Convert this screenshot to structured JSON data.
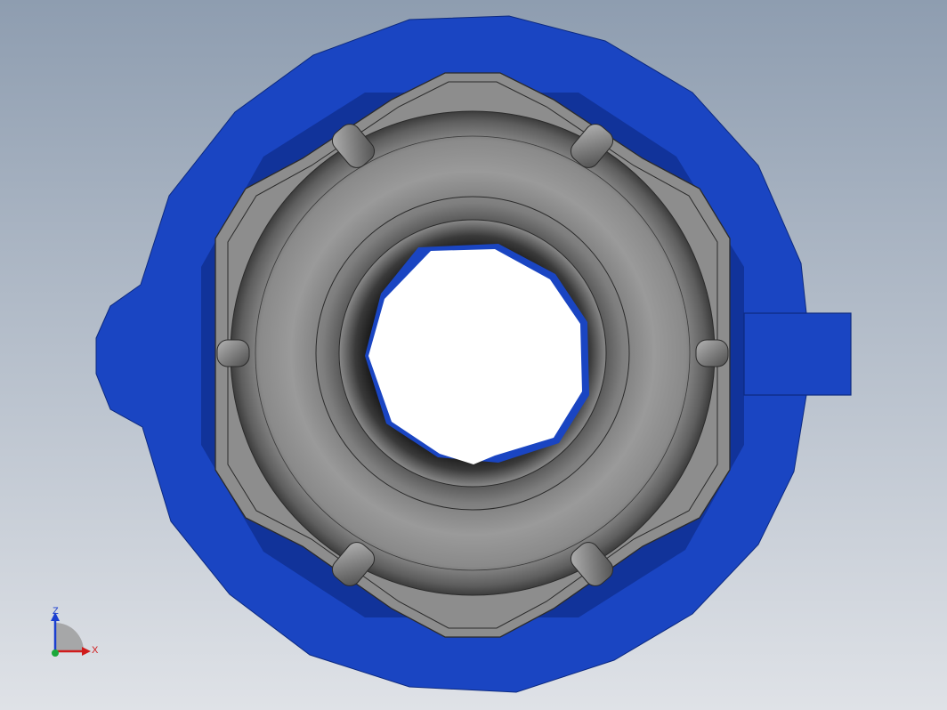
{
  "scene": {
    "background_top": "#8e9db0",
    "background_bottom": "#dfe2e7",
    "body_color": "#1a45c2",
    "body_dark": "#11339a",
    "nut_color": "#8a8a8a",
    "nut_edge": "#2b2b2b",
    "bore_color": "#ffffff"
  },
  "triad": {
    "axis_z_label": "Z",
    "axis_x_label": "X",
    "axis_z_color": "#1b3fd0",
    "axis_x_color": "#d01b1b",
    "axis_y_color": "#1ba83a"
  }
}
